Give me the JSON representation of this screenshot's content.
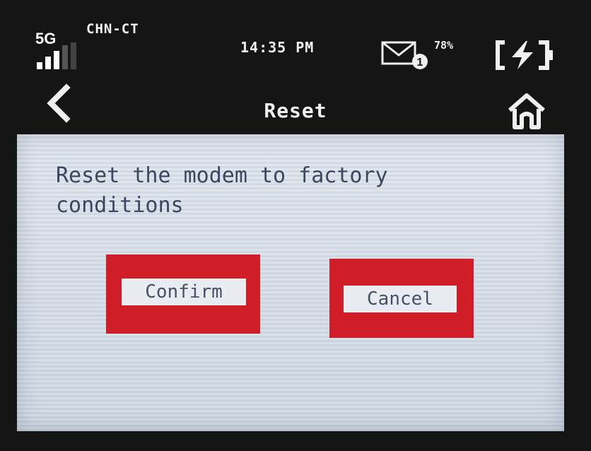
{
  "status_bar": {
    "network_type": "5G",
    "carrier": "CHN-CT",
    "time": "14:35 PM",
    "unread_messages": "1",
    "battery_percent": "78%",
    "battery_charging": true,
    "icons": [
      "signal-icon",
      "mail-icon",
      "battery-charging-icon"
    ]
  },
  "header": {
    "title": "Reset",
    "back_icon": "chevron-left-icon",
    "home_icon": "home-icon"
  },
  "dialog": {
    "message": "Reset the modem to factory conditions",
    "confirm_label": "Confirm",
    "cancel_label": "Cancel"
  },
  "colors": {
    "background": "#151515",
    "panel": "#d9e0e8",
    "button": "#d01e28",
    "text": "#3b4660"
  }
}
